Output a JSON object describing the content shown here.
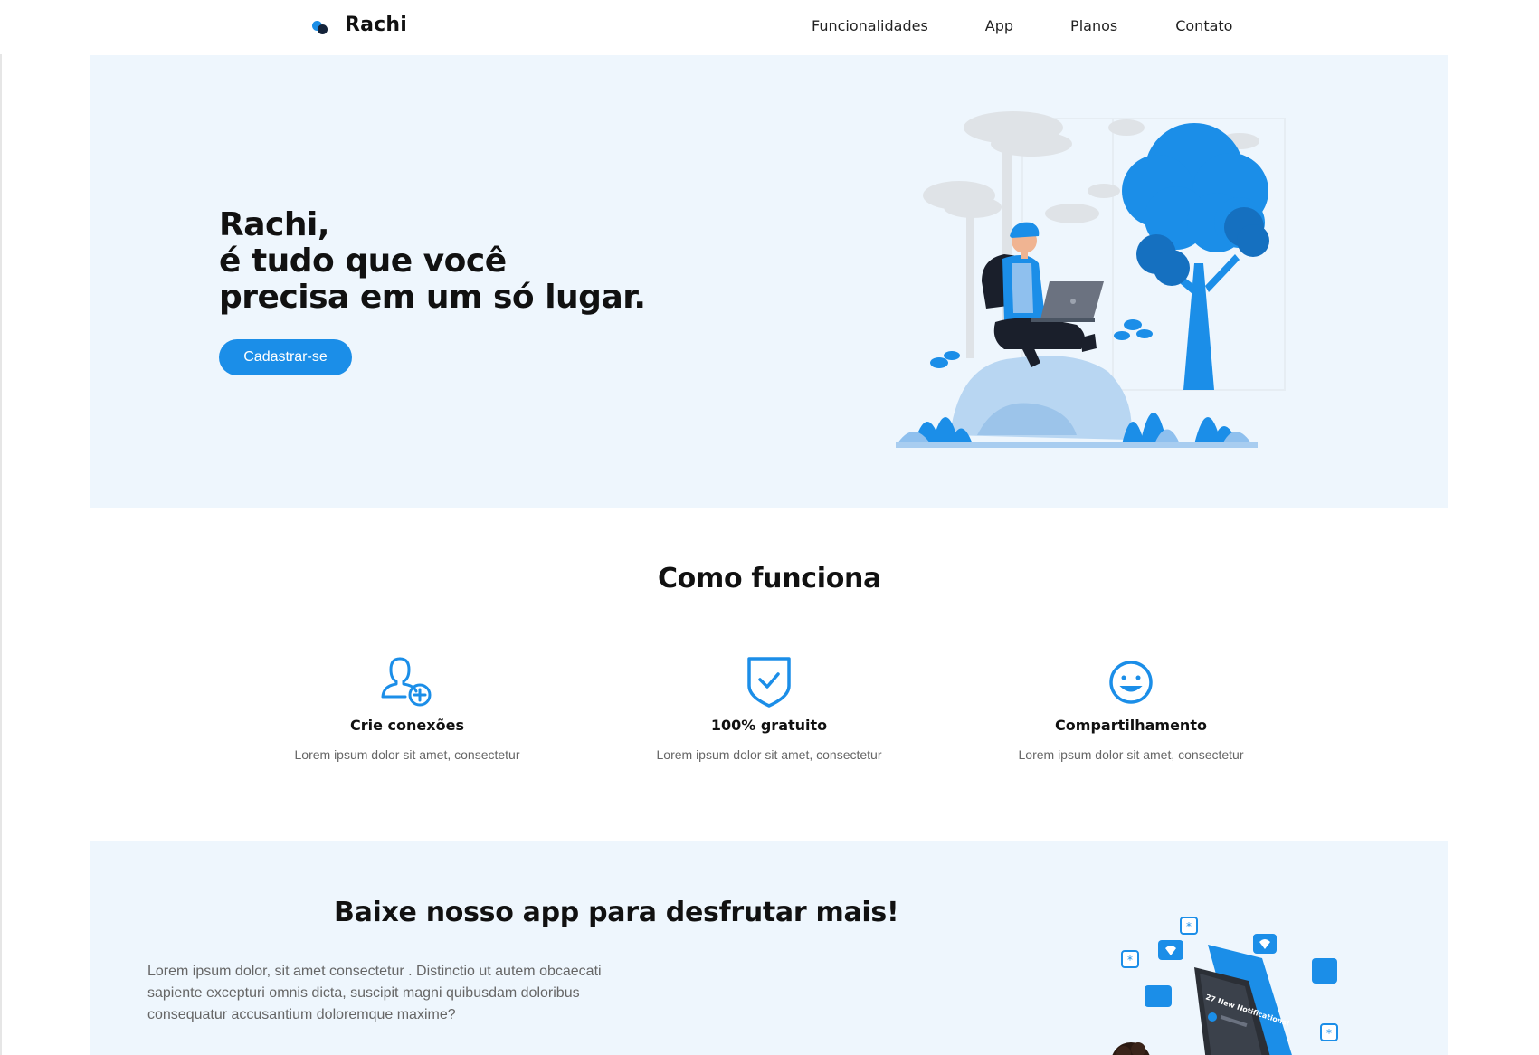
{
  "header": {
    "brand": "Rachi",
    "nav": [
      {
        "label": "Funcionalidades"
      },
      {
        "label": "App"
      },
      {
        "label": "Planos"
      },
      {
        "label": "Contato"
      }
    ]
  },
  "hero": {
    "title_lines": [
      "Rachi,",
      "é tudo que você",
      "precisa em um só lugar."
    ],
    "cta_label": "Cadastrar-se",
    "illustration_icon": "person-with-laptop-in-park-illustration"
  },
  "how": {
    "title": "Como funciona",
    "features": [
      {
        "icon": "user-add-icon",
        "title": "Crie conexões",
        "desc": "Lorem ipsum dolor sit amet, consectetur"
      },
      {
        "icon": "shield-check-icon",
        "title": "100% gratuito",
        "desc": "Lorem ipsum dolor sit amet, consectetur"
      },
      {
        "icon": "smiley-icon",
        "title": "Compartilhamento",
        "desc": "Lorem ipsum dolor sit amet, consectetur"
      }
    ]
  },
  "app": {
    "title": "Baixe nosso app para desfrutar mais!",
    "text": "Lorem ipsum dolor, sit amet consectetur . Distinctio ut autem obcaecati sapiente excepturi omnis dicta, suscipit magni quibusdam doloribus consequatur accusantium doloremque maxime?",
    "illustration_icon": "phone-notifications-illustration",
    "phone_banner": "27 New Notifications!"
  },
  "colors": {
    "accent": "#1b8ee8",
    "hero_bg": "#eef6fd",
    "text_dark": "#111111",
    "text_muted": "#666666"
  }
}
